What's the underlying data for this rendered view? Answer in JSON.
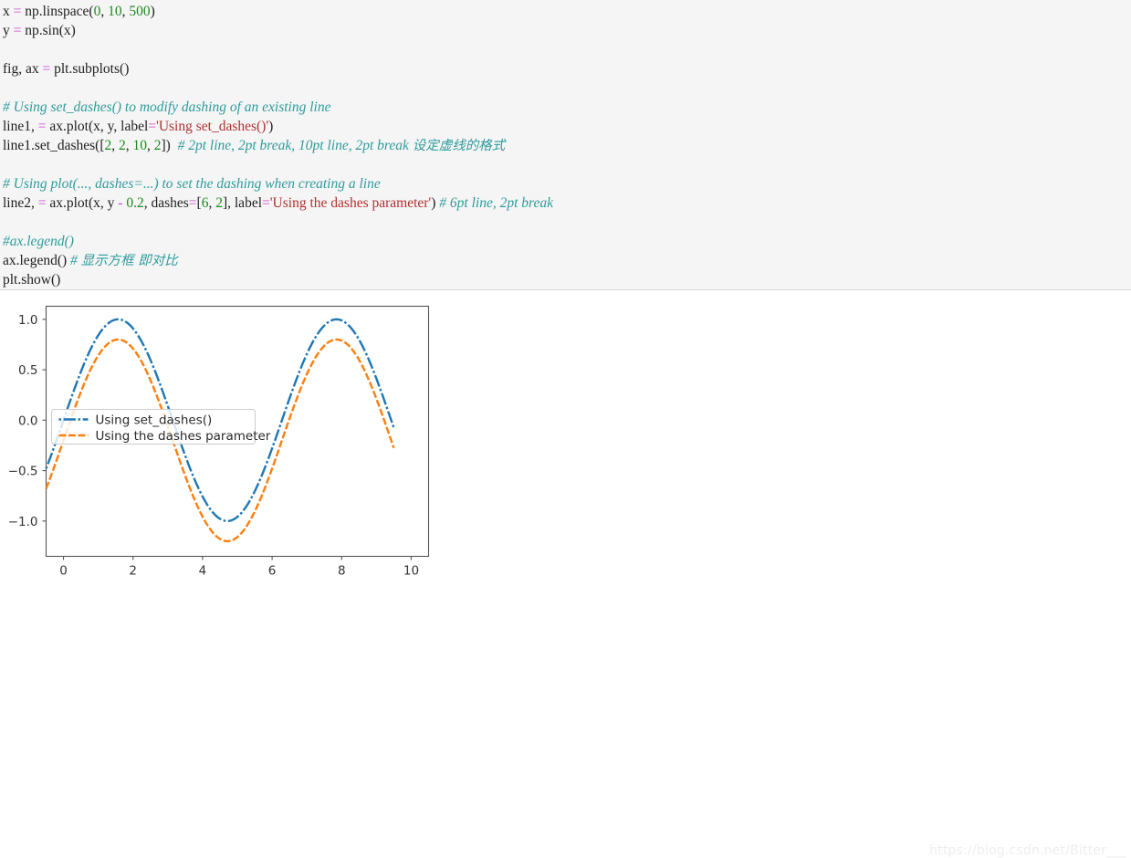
{
  "code": {
    "language": "python",
    "lines": [
      [
        {
          "t": "x ",
          "c": "name"
        },
        {
          "t": "= ",
          "c": "op"
        },
        {
          "t": "np.linspace",
          "c": "name"
        },
        {
          "t": "(",
          "c": "punct"
        },
        {
          "t": "0",
          "c": "num"
        },
        {
          "t": ", ",
          "c": "punct"
        },
        {
          "t": "10",
          "c": "num"
        },
        {
          "t": ", ",
          "c": "punct"
        },
        {
          "t": "500",
          "c": "num"
        },
        {
          "t": ")",
          "c": "punct"
        }
      ],
      [
        {
          "t": "y ",
          "c": "name"
        },
        {
          "t": "= ",
          "c": "op"
        },
        {
          "t": "np.sin",
          "c": "name"
        },
        {
          "t": "(x)",
          "c": "punct"
        }
      ],
      [],
      [
        {
          "t": "fig, ax ",
          "c": "name"
        },
        {
          "t": "= ",
          "c": "op"
        },
        {
          "t": "plt.subplots",
          "c": "name"
        },
        {
          "t": "()",
          "c": "punct"
        }
      ],
      [],
      [
        {
          "t": "# Using set_dashes() to modify dashing of an existing line",
          "c": "com"
        }
      ],
      [
        {
          "t": "line1, ",
          "c": "name"
        },
        {
          "t": "= ",
          "c": "op"
        },
        {
          "t": "ax.plot",
          "c": "name"
        },
        {
          "t": "(x, y, label",
          "c": "punct"
        },
        {
          "t": "=",
          "c": "op"
        },
        {
          "t": "'Using set_dashes()'",
          "c": "str"
        },
        {
          "t": ")",
          "c": "punct"
        }
      ],
      [
        {
          "t": "line1.set_dashes",
          "c": "name"
        },
        {
          "t": "([",
          "c": "punct"
        },
        {
          "t": "2",
          "c": "num"
        },
        {
          "t": ", ",
          "c": "punct"
        },
        {
          "t": "2",
          "c": "num"
        },
        {
          "t": ", ",
          "c": "punct"
        },
        {
          "t": "10",
          "c": "num"
        },
        {
          "t": ", ",
          "c": "punct"
        },
        {
          "t": "2",
          "c": "num"
        },
        {
          "t": "])  ",
          "c": "punct"
        },
        {
          "t": "# 2pt line, 2pt break, 10pt line, 2pt break ",
          "c": "com"
        },
        {
          "t": "设定虚线的格式",
          "c": "cn"
        }
      ],
      [],
      [
        {
          "t": "# Using plot(..., dashes=...) to set the dashing when creating a line",
          "c": "com"
        }
      ],
      [
        {
          "t": "line2, ",
          "c": "name"
        },
        {
          "t": "= ",
          "c": "op"
        },
        {
          "t": "ax.plot",
          "c": "name"
        },
        {
          "t": "(x, y ",
          "c": "punct"
        },
        {
          "t": "- ",
          "c": "op"
        },
        {
          "t": "0.2",
          "c": "num"
        },
        {
          "t": ", dashes",
          "c": "punct"
        },
        {
          "t": "=",
          "c": "op"
        },
        {
          "t": "[",
          "c": "punct"
        },
        {
          "t": "6",
          "c": "num"
        },
        {
          "t": ", ",
          "c": "punct"
        },
        {
          "t": "2",
          "c": "num"
        },
        {
          "t": "], label",
          "c": "punct"
        },
        {
          "t": "=",
          "c": "op"
        },
        {
          "t": "'Using the dashes parameter'",
          "c": "str"
        },
        {
          "t": ") ",
          "c": "punct"
        },
        {
          "t": "# 6pt line, 2pt break",
          "c": "com"
        }
      ],
      [],
      [
        {
          "t": "#ax.legend()",
          "c": "com"
        }
      ],
      [
        {
          "t": "ax.legend",
          "c": "name"
        },
        {
          "t": "() ",
          "c": "punct"
        },
        {
          "t": "# ",
          "c": "com"
        },
        {
          "t": "显示方框 即对比",
          "c": "cn"
        }
      ],
      [
        {
          "t": "plt.show",
          "c": "name"
        },
        {
          "t": "()",
          "c": "punct"
        }
      ]
    ]
  },
  "watermark": {
    "text": "https://blog.csdn.net/Bitter___"
  },
  "chart_data": {
    "type": "line",
    "title": "",
    "xlabel": "",
    "ylabel": "",
    "xlim": [
      -0.5,
      10.5
    ],
    "ylim": [
      -1.35,
      1.13
    ],
    "xticks": [
      0,
      2,
      4,
      6,
      8,
      10
    ],
    "yticks": [
      -1.0,
      -0.5,
      0.0,
      0.5,
      1.0
    ],
    "xticklabels": [
      "0",
      "2",
      "4",
      "6",
      "8",
      "10"
    ],
    "yticklabels": [
      "-1.0",
      "-0.5",
      "0.0",
      "0.5",
      "1.0"
    ],
    "grid": false,
    "legend_position": "center left",
    "x_expression": "np.linspace(0, 10, 500)",
    "series": [
      {
        "name": "Using set_dashes()",
        "formula": "sin(x)",
        "color": "#1f77b4",
        "dashes": [
          2,
          2,
          10,
          2
        ],
        "dash_units": "pt",
        "linewidth": 2.4,
        "amplitude": 1.0,
        "offset": 0.0
      },
      {
        "name": "Using the dashes parameter",
        "formula": "sin(x) - 0.2",
        "color": "#ff7f0e",
        "dashes": [
          6,
          2
        ],
        "dash_units": "pt",
        "linewidth": 2.4,
        "amplitude": 1.0,
        "offset": -0.2
      }
    ]
  }
}
